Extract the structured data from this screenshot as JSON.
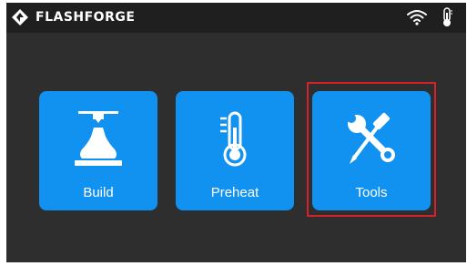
{
  "header": {
    "brand": "FLASHFORGE",
    "logo_icon": "flashforge-logo-icon",
    "status_icons": [
      "wifi-icon",
      "thermometer-icon"
    ]
  },
  "tiles": [
    {
      "label": "Build",
      "icon": "printer-nozzle-icon"
    },
    {
      "label": "Preheat",
      "icon": "thermometer-icon"
    },
    {
      "label": "Tools",
      "icon": "wrench-screwdriver-icon"
    }
  ],
  "colors": {
    "background": "#2e2e2e",
    "header": "#1f1f1f",
    "tile": "#1292f0",
    "highlight": "#d6202a"
  }
}
